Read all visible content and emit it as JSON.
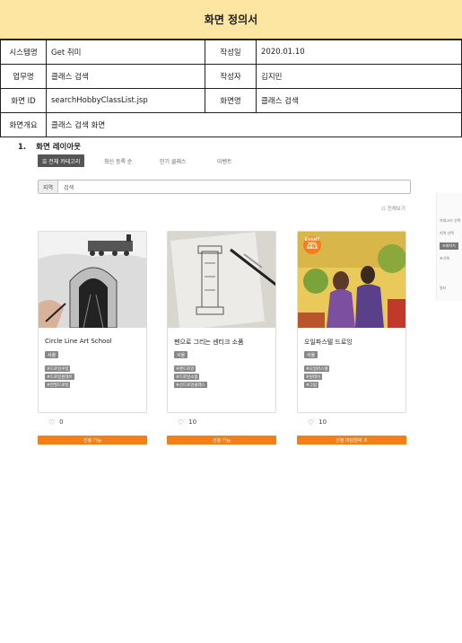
{
  "doc": {
    "title": "화면 정의서"
  },
  "meta": {
    "system_label": "시스템명",
    "system_value": "Get 취미",
    "created_label": "작성일",
    "created_value": "2020.01.10",
    "task_label": "업무명",
    "task_value": "클래스 검색",
    "author_label": "작성자",
    "author_value": "김지민",
    "screen_id_label": "화면 ID",
    "screen_id_value": "searchHobbyClassList.jsp",
    "screen_name_label": "화면명",
    "screen_name_value": "클래스 검색",
    "overview_label": "화면개요",
    "overview_value": "클래스 검색 화면"
  },
  "section": {
    "number": "1.",
    "title": "화면 레이아웃"
  },
  "mock": {
    "tabs": {
      "all": "☰ 전체 카테고리",
      "recent": "최신 등록 순",
      "popular": "인기 클래스",
      "event": "이벤트"
    },
    "search": {
      "area": "지역",
      "query": "검색"
    },
    "filter_link": "☷ 전체보기",
    "cards": [
      {
        "title": "Circle Line Art School",
        "region": "서울",
        "tags": [
          "#드로잉수업",
          "#드로잉원데이",
          "#연필드로잉"
        ],
        "likes": "0",
        "button": "신청 가능"
      },
      {
        "title": "펜으로 그리는 센티크 소품",
        "region": "서울",
        "tags": [
          "#펜드로잉",
          "#드로잉소품",
          "#선드로잉클래스"
        ],
        "likes": "10",
        "button": "신청 가능"
      },
      {
        "title": "오일파스텔 드로잉",
        "region": "서울",
        "tags": [
          "#오일파스텔",
          "#원데이",
          "#그림"
        ],
        "likes": "10",
        "button": "신청 마감임박 조",
        "badge": "EVENT 20% SALE"
      }
    ],
    "side": {
      "r1": "카테고리 선택",
      "r2": "지역 선택",
      "r3": "조회하기",
      "r4": "초기화",
      "r5": "필터"
    }
  }
}
